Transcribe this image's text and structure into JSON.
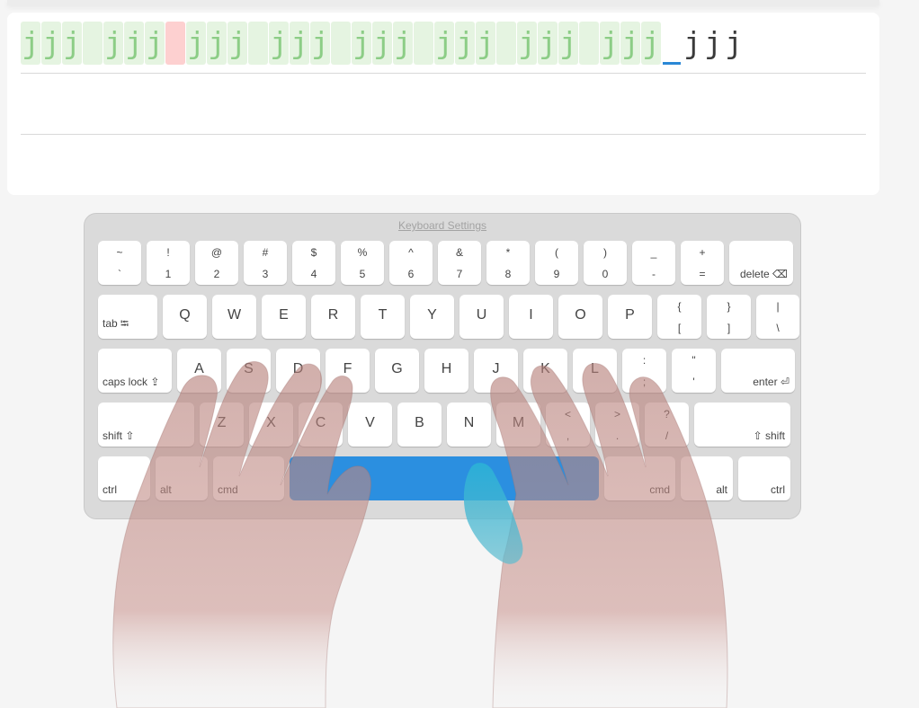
{
  "lesson": {
    "chars": [
      {
        "c": "j",
        "state": "correct"
      },
      {
        "c": "j",
        "state": "correct"
      },
      {
        "c": "j",
        "state": "correct"
      },
      {
        "c": " ",
        "state": "correct"
      },
      {
        "c": "j",
        "state": "correct"
      },
      {
        "c": "j",
        "state": "correct"
      },
      {
        "c": "j",
        "state": "correct"
      },
      {
        "c": " ",
        "state": "error"
      },
      {
        "c": "j",
        "state": "correct"
      },
      {
        "c": "j",
        "state": "correct"
      },
      {
        "c": "j",
        "state": "correct"
      },
      {
        "c": " ",
        "state": "correct"
      },
      {
        "c": "j",
        "state": "correct"
      },
      {
        "c": "j",
        "state": "correct"
      },
      {
        "c": "j",
        "state": "correct"
      },
      {
        "c": " ",
        "state": "correct"
      },
      {
        "c": "j",
        "state": "correct"
      },
      {
        "c": "j",
        "state": "correct"
      },
      {
        "c": "j",
        "state": "correct"
      },
      {
        "c": " ",
        "state": "correct"
      },
      {
        "c": "j",
        "state": "correct"
      },
      {
        "c": "j",
        "state": "correct"
      },
      {
        "c": "j",
        "state": "correct"
      },
      {
        "c": " ",
        "state": "correct"
      },
      {
        "c": "j",
        "state": "correct"
      },
      {
        "c": "j",
        "state": "correct"
      },
      {
        "c": "j",
        "state": "correct"
      },
      {
        "c": " ",
        "state": "correct"
      },
      {
        "c": "j",
        "state": "correct"
      },
      {
        "c": "j",
        "state": "correct"
      },
      {
        "c": "j",
        "state": "correct"
      },
      {
        "c": " ",
        "state": "current"
      },
      {
        "c": "j",
        "state": "pending"
      },
      {
        "c": "j",
        "state": "pending"
      },
      {
        "c": "j",
        "state": "pending"
      }
    ],
    "colors": {
      "correct_bg": "#e5f4e1",
      "correct_text": "#8ccd86",
      "error_bg": "#fdd0d0",
      "cursor": "#2a88d6"
    }
  },
  "keyboard": {
    "settings_link": "Keyboard Settings",
    "space_color": "#2b8fe0",
    "rows": [
      [
        {
          "name": "key-tilde",
          "shift": "~",
          "base": "`"
        },
        {
          "name": "key-1",
          "shift": "!",
          "base": "1"
        },
        {
          "name": "key-2",
          "shift": "@",
          "base": "2"
        },
        {
          "name": "key-3",
          "shift": "#",
          "base": "3"
        },
        {
          "name": "key-4",
          "shift": "$",
          "base": "4"
        },
        {
          "name": "key-5",
          "shift": "%",
          "base": "5"
        },
        {
          "name": "key-6",
          "shift": "^",
          "base": "6"
        },
        {
          "name": "key-7",
          "shift": "&",
          "base": "7"
        },
        {
          "name": "key-8",
          "shift": "*",
          "base": "8"
        },
        {
          "name": "key-9",
          "shift": "(",
          "base": "9"
        },
        {
          "name": "key-0",
          "shift": ")",
          "base": "0"
        },
        {
          "name": "key-minus",
          "shift": "_",
          "base": "-"
        },
        {
          "name": "key-equals",
          "shift": "+",
          "base": "="
        },
        {
          "name": "key-delete",
          "right": "delete ⌫"
        }
      ],
      [
        {
          "name": "key-tab",
          "left": "tab ⭾"
        },
        {
          "name": "key-q",
          "letter": "Q"
        },
        {
          "name": "key-w",
          "letter": "W"
        },
        {
          "name": "key-e",
          "letter": "E"
        },
        {
          "name": "key-r",
          "letter": "R"
        },
        {
          "name": "key-t",
          "letter": "T"
        },
        {
          "name": "key-y",
          "letter": "Y"
        },
        {
          "name": "key-u",
          "letter": "U"
        },
        {
          "name": "key-i",
          "letter": "I"
        },
        {
          "name": "key-o",
          "letter": "O"
        },
        {
          "name": "key-p",
          "letter": "P"
        },
        {
          "name": "key-open-bracket",
          "shift": "{",
          "base": "["
        },
        {
          "name": "key-close-bracket",
          "shift": "}",
          "base": "]"
        },
        {
          "name": "key-backslash",
          "shift": "|",
          "base": "\\"
        }
      ],
      [
        {
          "name": "key-caps-lock",
          "left": "caps lock ⇪"
        },
        {
          "name": "key-a",
          "letter": "A"
        },
        {
          "name": "key-s",
          "letter": "S"
        },
        {
          "name": "key-d",
          "letter": "D"
        },
        {
          "name": "key-f",
          "letter": "F"
        },
        {
          "name": "key-g",
          "letter": "G"
        },
        {
          "name": "key-h",
          "letter": "H"
        },
        {
          "name": "key-j",
          "letter": "J"
        },
        {
          "name": "key-k",
          "letter": "K"
        },
        {
          "name": "key-l",
          "letter": "L"
        },
        {
          "name": "key-semicolon",
          "shift": ":",
          "base": ";"
        },
        {
          "name": "key-quote",
          "shift": "\"",
          "base": "'"
        },
        {
          "name": "key-enter",
          "right": "enter ⏎"
        }
      ],
      [
        {
          "name": "key-shift-left",
          "left": "shift ⇧"
        },
        {
          "name": "key-z",
          "letter": "Z"
        },
        {
          "name": "key-x",
          "letter": "X"
        },
        {
          "name": "key-c",
          "letter": "C"
        },
        {
          "name": "key-v",
          "letter": "V"
        },
        {
          "name": "key-b",
          "letter": "B"
        },
        {
          "name": "key-n",
          "letter": "N"
        },
        {
          "name": "key-m",
          "letter": "M"
        },
        {
          "name": "key-comma",
          "shift": "<",
          "base": ","
        },
        {
          "name": "key-period",
          "shift": ">",
          "base": "."
        },
        {
          "name": "key-slash",
          "shift": "?",
          "base": "/"
        },
        {
          "name": "key-shift-right",
          "right": "⇧ shift"
        }
      ],
      [
        {
          "name": "key-ctrl-left",
          "left": "ctrl"
        },
        {
          "name": "key-alt-left",
          "left": "alt"
        },
        {
          "name": "key-cmd-left",
          "left": "cmd"
        },
        {
          "name": "key-space",
          "space": true
        },
        {
          "name": "key-cmd-right",
          "right": "cmd"
        },
        {
          "name": "key-alt-right",
          "right": "alt"
        },
        {
          "name": "key-ctrl-right",
          "right": "ctrl"
        }
      ]
    ]
  }
}
